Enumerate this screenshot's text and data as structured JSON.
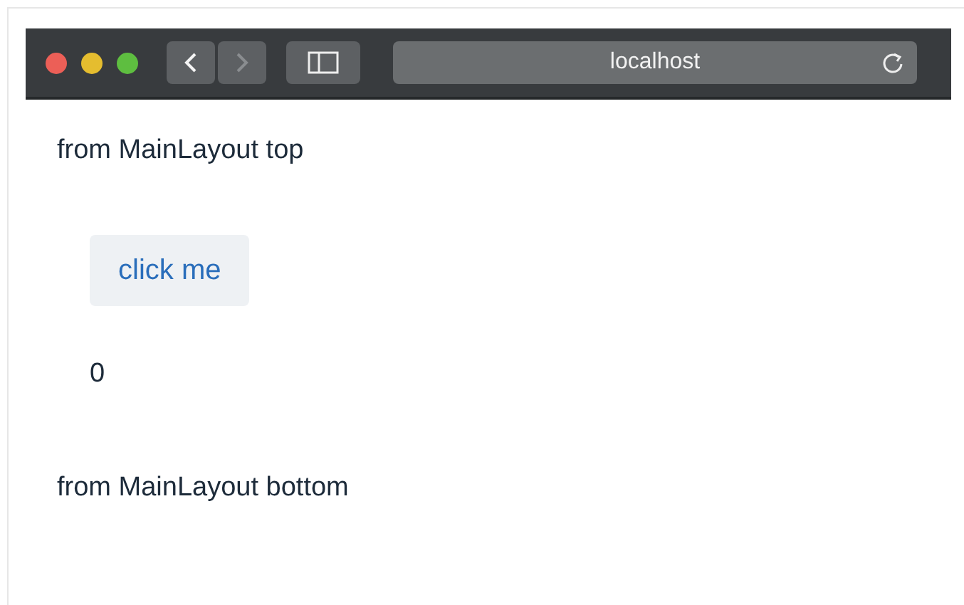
{
  "browser": {
    "address": "localhost",
    "nav_buttons": [
      {
        "kind": "back",
        "disabled": false
      },
      {
        "kind": "forward",
        "disabled": true
      }
    ]
  },
  "page": {
    "top_text": "from MainLayout top",
    "button": "click me",
    "counter": "0",
    "bottom_text": "from MainLayout bottom"
  }
}
